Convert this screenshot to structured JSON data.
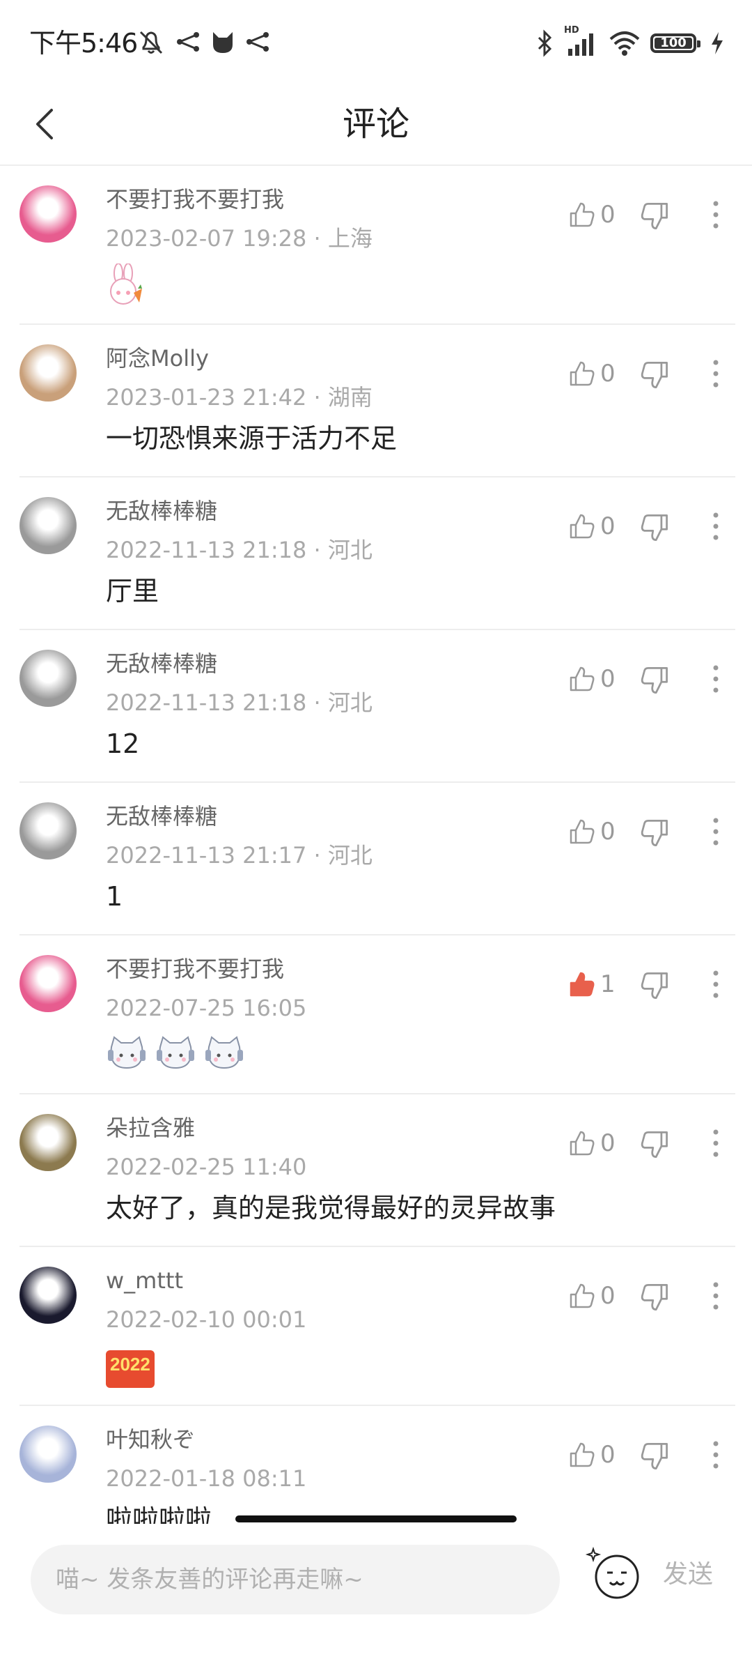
{
  "status_bar": {
    "time": "下午5:46",
    "battery": "100",
    "icons": [
      "mute-icon",
      "share-icon",
      "cat-icon",
      "share-icon",
      "bluetooth-icon",
      "signal-icon",
      "wifi-icon",
      "battery-icon",
      "charging-icon"
    ],
    "signal_label": "HD"
  },
  "header": {
    "title": "评论",
    "back_icon": "chevron-left-icon"
  },
  "comments": [
    {
      "name": "不要打我不要打我",
      "meta": "2023-02-07 19:28 · 上海",
      "text": "",
      "sticker": "bunny-sticker",
      "likes": "0",
      "liked": false,
      "avatar_color": "#e75c8f"
    },
    {
      "name": "阿念Molly",
      "meta": "2023-01-23 21:42 · 湖南",
      "text": "一切恐惧来源于活力不足",
      "likes": "0",
      "liked": false,
      "avatar_color": "#c9a07a"
    },
    {
      "name": "无敌棒棒糖",
      "meta": "2022-11-13 21:18 · 河北",
      "text": "厅里",
      "likes": "0",
      "liked": false,
      "avatar_color": "#9a9a9a"
    },
    {
      "name": "无敌棒棒糖",
      "meta": "2022-11-13 21:18 · 河北",
      "text": "12",
      "likes": "0",
      "liked": false,
      "avatar_color": "#9a9a9a"
    },
    {
      "name": "无敌棒棒糖",
      "meta": "2022-11-13 21:17 · 河北",
      "text": "1",
      "likes": "0",
      "liked": false,
      "avatar_color": "#9a9a9a"
    },
    {
      "name": "不要打我不要打我",
      "meta": "2022-07-25 16:05",
      "text": "",
      "sticker": "cat-headphone-sticker",
      "likes": "1",
      "liked": true,
      "avatar_color": "#e75c8f"
    },
    {
      "name": "朵拉含雅",
      "meta": "2022-02-25 11:40",
      "text": "太好了，真的是我觉得最好的灵异故事",
      "likes": "0",
      "liked": false,
      "avatar_color": "#8c7a4f"
    },
    {
      "name": "w_mttt",
      "meta": "2022-02-10 00:01",
      "text": "",
      "sticker": "2022-sticker",
      "sticker_text": "2022",
      "likes": "0",
      "liked": false,
      "avatar_color": "#1a1a2e"
    },
    {
      "name": "叶知秋ぞ",
      "meta": "2022-01-18 08:11",
      "text": "啦啦啦啦",
      "likes": "0",
      "liked": false,
      "avatar_color": "#a7b4d9"
    }
  ],
  "input": {
    "placeholder": "喵~ 发条友善的评论再走嘛~",
    "send_label": "发送",
    "emoji_icon": "emoji-face-icon"
  },
  "colors": {
    "liked": "#e8604c",
    "muted": "#a9a9a9",
    "divider": "#ededed"
  }
}
